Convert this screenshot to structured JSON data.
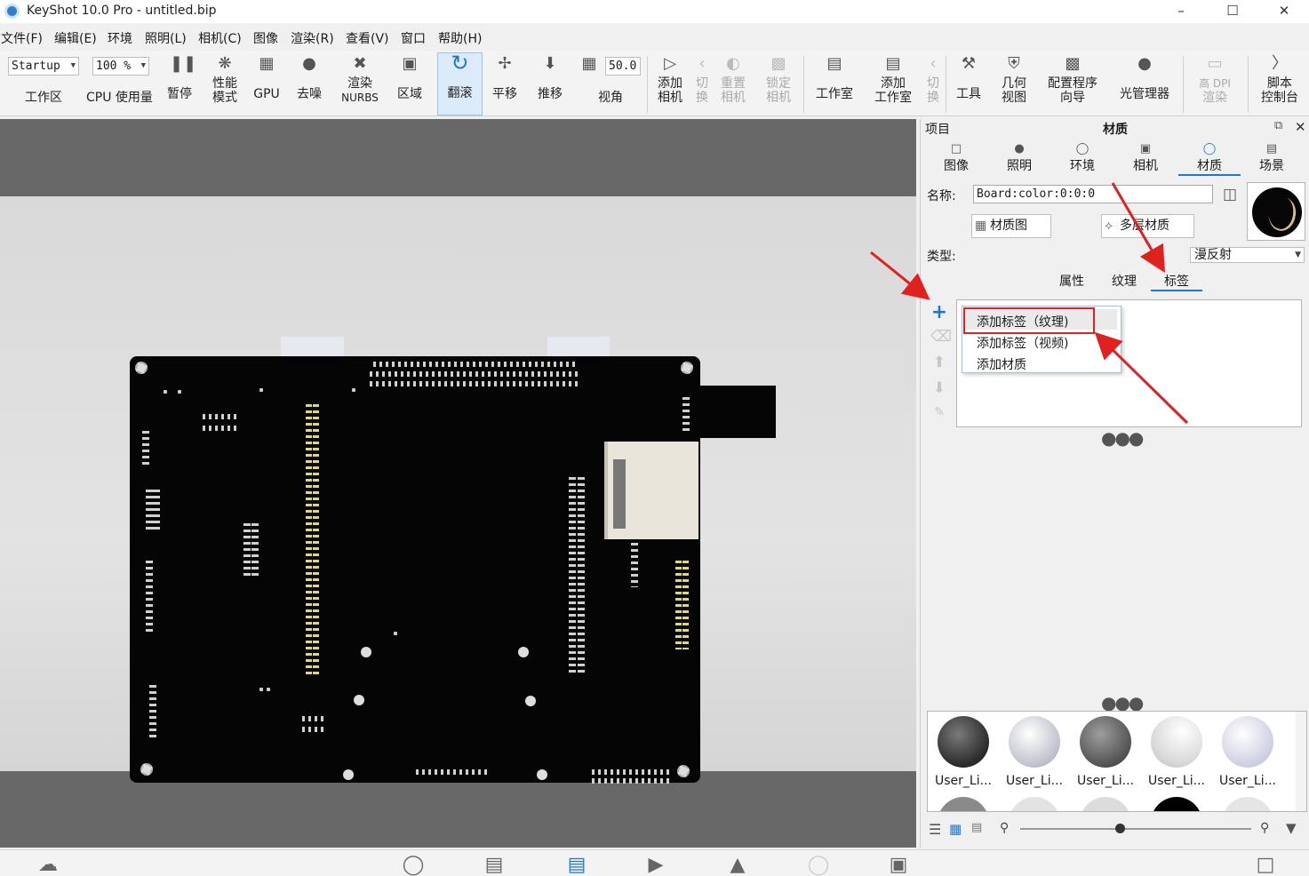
{
  "window": {
    "title": "KeyShot 10.0 Pro  - untitled.bip",
    "controls": [
      "minimize-icon",
      "maximize-icon",
      "close-icon"
    ]
  },
  "menu": [
    "文件(F)",
    "编辑(E)",
    "环境",
    "照明(L)",
    "相机(C)",
    "图像",
    "渲染(R)",
    "查看(V)",
    "窗口",
    "帮助(H)"
  ],
  "toolbar": {
    "workspace_value": "Startup",
    "workspace_label": "工作区",
    "cpu_value": "100 %",
    "cpu_label": "CPU 使用量",
    "pause": "暂停",
    "performance_l1": "性能",
    "performance_l2": "模式",
    "gpu": "GPU",
    "denoise": "去噪",
    "nurbs_l1": "渲染",
    "nurbs_l2": "NURBS",
    "region": "区域",
    "tumble": "翻滚",
    "pan": "平移",
    "dolly": "推移",
    "fov_value": "50.0",
    "fov_label": "视角",
    "add_camera_l1": "添加",
    "add_camera_l2": "相机",
    "switch_l1": "切",
    "switch_l2": "换",
    "reset_l1": "重置",
    "reset_l2": "相机",
    "lock_l1": "锁定",
    "lock_l2": "相机",
    "studio": "工作室",
    "add_studio_l1": "添加",
    "add_studio_l2": "工作室",
    "switch2_l1": "切",
    "switch2_l2": "换",
    "tools": "工具",
    "geometry_l1": "几何",
    "geometry_l2": "视图",
    "config_l1": "配置程序",
    "config_l2": "向导",
    "light_manager": "光管理器",
    "hidpi_l1": "高 DPI",
    "hidpi_l2": "渲染",
    "script_l1": "脚本",
    "script_l2": "控制台"
  },
  "panel": {
    "header_left": "项目",
    "header_title": "材质",
    "tabs": [
      "图像",
      "照明",
      "环境",
      "相机",
      "材质",
      "场景"
    ],
    "name_label": "名称:",
    "name_value": "Board:color:0:0:0",
    "material_graph": "材质图",
    "multi_material": "多层材质",
    "type_label": "类型:",
    "type_value": "漫反射",
    "subtabs": [
      "属性",
      "纹理",
      "标签"
    ]
  },
  "context_menu": [
    "添加标签（纹理)",
    "添加标签（视频)",
    "添加材质"
  ],
  "library": {
    "items": [
      "User_Li...",
      "User_Li...",
      "User_Li...",
      "User_Li...",
      "User_Li..."
    ]
  },
  "colors": {
    "accent": "#1e78d0",
    "annotation": "#e0211e",
    "board": "#050505",
    "viewport_bg": "#686868"
  }
}
